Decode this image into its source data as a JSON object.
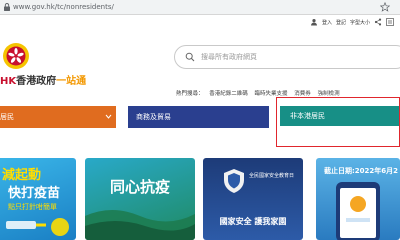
{
  "browser": {
    "url": "www.gov.hk/tc/nonresidents/"
  },
  "topnav": {
    "items": [
      "登入",
      "登記",
      "字型大小"
    ]
  },
  "logo": {
    "hk": "HK",
    "gov": "香港政府",
    "onestop": "一站通"
  },
  "search": {
    "placeholder": "搜尋所有政府網頁"
  },
  "popular": {
    "label": "熱門搜尋：",
    "items": [
      "香港紀錄二維碼",
      "臨時失業支援",
      "消費券",
      "強制檢測"
    ]
  },
  "tabs": {
    "residents": "居民",
    "business": "商務及貿易",
    "nonresidents": "非本港居民"
  },
  "banners": {
    "card1": {
      "line1": "減起動",
      "line2": "快打疫苗",
      "line3": "點只打針咁簡單"
    },
    "card2": {
      "title": "同心抗疫"
    },
    "card3": {
      "small": "全民國家安全教育日",
      "title": "國家安全 護我家園"
    },
    "card4": {
      "title": "截止日期:2022年6月2"
    }
  },
  "colors": {
    "residents": "#e06c1f",
    "business": "#2a3f8f",
    "nonresidents": "#178f86",
    "highlight": "#e0262d"
  }
}
